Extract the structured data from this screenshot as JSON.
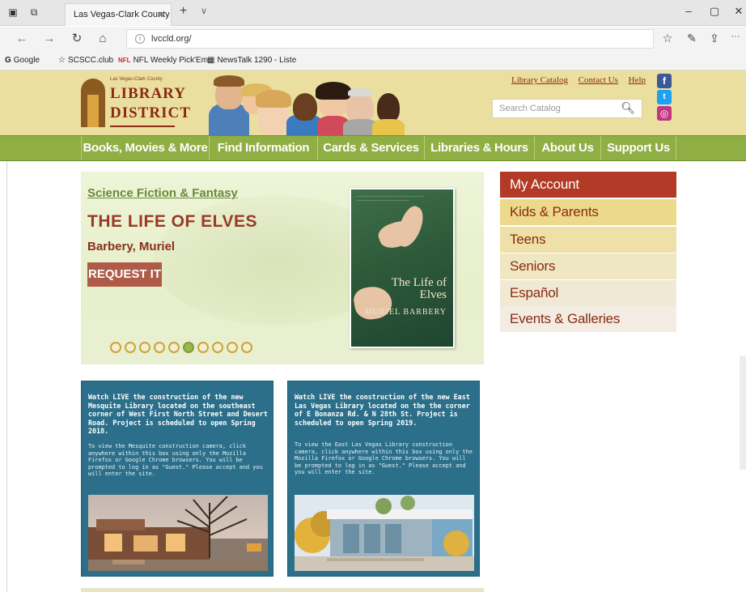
{
  "browser": {
    "tab_title": "Las Vegas-Clark County",
    "tab_close": "×",
    "new_tab": "+",
    "tab_list": "∨",
    "url": "lvccld.org/",
    "window": {
      "minimize": "–",
      "maximize": "▢",
      "close": "✕"
    },
    "nav": {
      "back": "←",
      "forward": "→",
      "refresh": "↻",
      "home": "⌂"
    },
    "toolbar_right": {
      "favorites": "☆",
      "reading": "✎",
      "share": "⇪",
      "more": "···"
    },
    "favorites": [
      {
        "icon": "G",
        "label": "Google"
      },
      {
        "icon": "☆",
        "label": "SCSCC.club"
      },
      {
        "icon": "NFL",
        "label": "NFL Weekly Pick'Em"
      },
      {
        "icon": "▦",
        "label": "NewsTalk 1290 - Liste"
      }
    ]
  },
  "header": {
    "logo_small": "Las Vegas-Clark County",
    "logo_line1": "LIBRARY",
    "logo_line2": "DISTRICT",
    "links": [
      "Library Catalog",
      "Contact Us",
      "Help"
    ],
    "search_placeholder": "Search Catalog",
    "social": {
      "facebook": "f",
      "twitter": "t",
      "instagram": "◎"
    },
    "colors": {
      "band": "#ebdf9f",
      "brand": "#8a2a12"
    }
  },
  "main_nav": [
    "Books, Movies & More",
    "Find Information",
    "Cards & Services",
    "Libraries & Hours",
    "About Us",
    "Support Us"
  ],
  "carousel": {
    "category": "Science Fiction & Fantasy",
    "title": "THE LIFE OF ELVES",
    "author": "Barbery, Muriel",
    "button": "REQUEST IT",
    "book_cover_title": "The Life of Elves",
    "book_cover_author": "MURIEL BARBERY",
    "dot_count": 10,
    "active_dot": 5
  },
  "side_menu": [
    {
      "label": "My Account",
      "bg": "#b33a26",
      "fg": "#ffffff"
    },
    {
      "label": "Kids & Parents",
      "bg": "#ecd98b",
      "fg": "#8a2a12"
    },
    {
      "label": "Teens",
      "bg": "#eee0a8",
      "fg": "#8a2a12"
    },
    {
      "label": "Seniors",
      "bg": "#efe6c2",
      "fg": "#8a2a12"
    },
    {
      "label": "Español",
      "bg": "#f0e9d4",
      "fg": "#8a2a12"
    },
    {
      "label": "Events & Galleries",
      "bg": "#f2ece2",
      "fg": "#8a2a12"
    }
  ],
  "info_boxes": [
    {
      "heading": "Watch LIVE the construction of the new Mesquite Library located on the southeast corner of West First North Street and Desert Road. Project is scheduled to open Spring 2018.",
      "body": "To view the Mesquite construction camera, click anywhere within this box using only the Mozilla Firefox or Google Chrome browsers. You will be prompted to log in as \"Guest.\" Please accept and you will enter the site."
    },
    {
      "heading": "Watch LIVE the construction of the new East Las Vegas Library located on the the corner of E Bonanza Rd. & N 28th St. Project is scheduled to open Spring 2019.",
      "body": "To view the East Las Vegas Library construction camera, click anywhere within this box using only the Mozilla Firefox or Google Chrome browsers. You will be prompted to log in as \"Guest.\" Please accept and you will enter the site."
    }
  ]
}
